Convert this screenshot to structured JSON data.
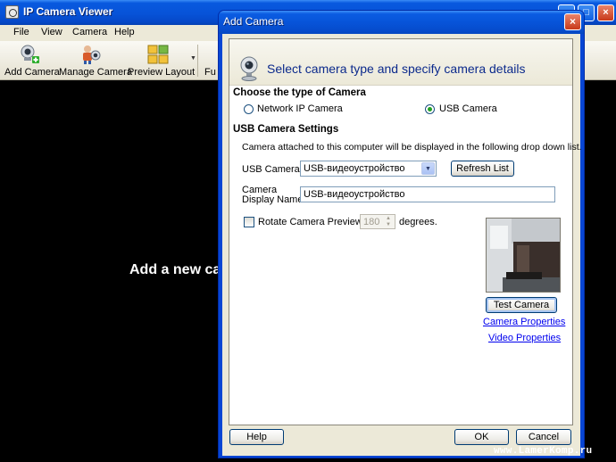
{
  "main_window": {
    "title": "IP Camera Viewer",
    "menu": [
      "File",
      "View",
      "Camera",
      "Help"
    ],
    "toolbar": {
      "add_camera": "Add Camera",
      "manage_camera": "Manage Camera",
      "preview_layout": "Preview Layout",
      "fullscreen_partial": "Fu"
    },
    "viewer_message": "Add a new ca"
  },
  "dialog": {
    "title": "Add Camera",
    "header": "Select camera type and specify camera details",
    "camera_type": {
      "group_title": "Choose the type of Camera",
      "network_option": "Network IP Camera",
      "usb_option": "USB Camera",
      "selected": "USB Camera"
    },
    "usb_settings": {
      "group_title": "USB Camera Settings",
      "description": "Camera attached to this computer will be displayed in the following drop down list.",
      "usb_camera_label": "USB Camera:",
      "usb_camera_value": "USB-видеоустройство",
      "refresh_button": "Refresh List",
      "display_name_label_line1": "Camera",
      "display_name_label_line2": "Display Name:",
      "display_name_value": "USB-видеоустройство",
      "rotate_label": "Rotate Camera Preview by",
      "rotate_value": "180",
      "rotate_unit": "degrees.",
      "rotate_checked": false,
      "test_button": "Test Camera",
      "camera_properties_link": "Camera Properties",
      "video_properties_link": "Video Properties"
    },
    "buttons": {
      "help": "Help",
      "ok": "OK",
      "cancel": "Cancel"
    }
  },
  "watermark": "www.LamerKomp.ru",
  "colors": {
    "titlebar": "#0754d8",
    "dialog_face": "#ece9d8",
    "radio_dot": "#21a121",
    "link": "#0000ee",
    "close_button": "#c8391a"
  }
}
